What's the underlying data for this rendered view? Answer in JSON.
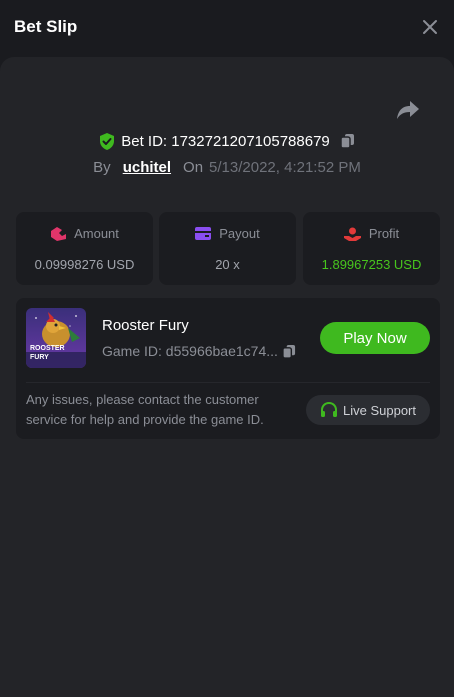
{
  "header": {
    "title": "Bet Slip"
  },
  "bet": {
    "id_label": "Bet ID: 1732721207105788679",
    "by_label": "By",
    "user": "uchitel",
    "on_label": "On",
    "date": "5/13/2022, 4:21:52 PM"
  },
  "stats": [
    {
      "label": "Amount",
      "value": "0.09998276 USD",
      "icon": "amount-icon"
    },
    {
      "label": "Payout",
      "value": "20 x",
      "icon": "card-icon"
    },
    {
      "label": "Profit",
      "value": "1.89967253 USD",
      "icon": "profit-icon"
    }
  ],
  "game": {
    "name": "Rooster Fury",
    "id_label": "Game ID: d55966bae1c74...",
    "play_label": "Play Now",
    "thumb_text_1": "ROOSTER",
    "thumb_text_2": "FURY"
  },
  "support": {
    "message": "Any issues, please contact the customer service for help and provide the game ID.",
    "button_label": "Live Support"
  },
  "colors": {
    "accent_green": "#3fb91f",
    "profit_green": "#47c51d",
    "amount_pink": "#e0356a",
    "payout_purple": "#8a4ef0",
    "profit_red": "#e23a3a"
  }
}
